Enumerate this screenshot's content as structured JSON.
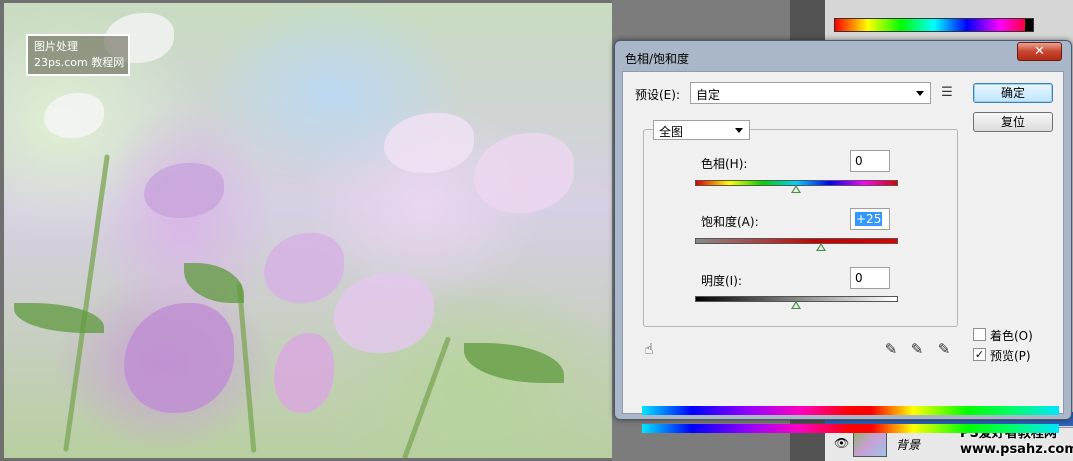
{
  "canvas": {
    "watermark_line1": "图片处理",
    "watermark_line2": "23ps.com",
    "watermark_line3": "教程网"
  },
  "layers_panel": {
    "layer_name": "背景"
  },
  "footer_watermark": {
    "line1": "PS爱好者教程网",
    "line2": "www.psahz.com"
  },
  "dialog": {
    "title": "色相/饱和度",
    "close_label": "✕",
    "preset_label": "预设(E):",
    "preset_value": "自定",
    "ok_label": "确定",
    "reset_label": "复位",
    "channel_value": "全图",
    "hue_label": "色相(H):",
    "hue_value": "0",
    "saturation_label": "饱和度(A):",
    "saturation_value": "+25",
    "lightness_label": "明度(I):",
    "lightness_value": "0",
    "colorize_label": "着色(O)",
    "preview_label": "预览(P)",
    "colorize_checked": false,
    "preview_checked": true,
    "preview_checkmark": "✓"
  },
  "icons": [
    "menu-list-icon",
    "hand-target-icon",
    "eyedropper-icon",
    "eyedropper-plus-icon",
    "eyedropper-minus-icon",
    "eye-icon"
  ]
}
